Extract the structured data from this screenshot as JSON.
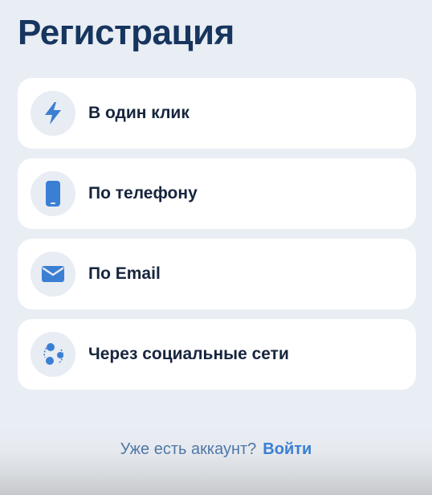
{
  "page": {
    "title": "Регистрация"
  },
  "options": [
    {
      "label": "В один клик",
      "icon": "lightning-icon"
    },
    {
      "label": "По телефону",
      "icon": "phone-icon"
    },
    {
      "label": "По Email",
      "icon": "envelope-icon"
    },
    {
      "label": "Через социальные сети",
      "icon": "social-network-icon"
    }
  ],
  "footer": {
    "prompt": "Уже есть аккаунт?",
    "login_link": "Войти"
  },
  "colors": {
    "accent": "#3a7fd4",
    "title": "#16355f",
    "background": "#e9edf4"
  }
}
